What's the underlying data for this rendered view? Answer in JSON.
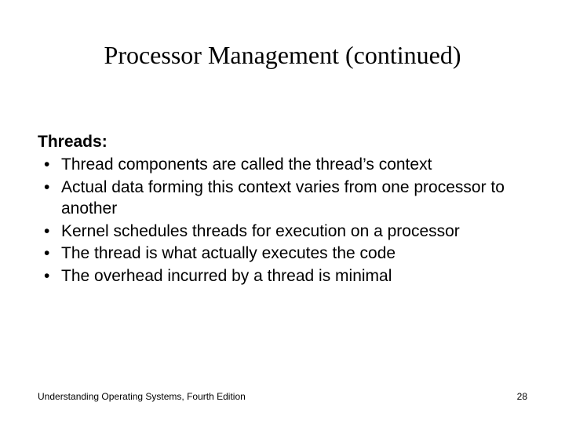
{
  "title": "Processor Management (continued)",
  "heading": "Threads:",
  "bullets": [
    "Thread components are called the thread’s context",
    "Actual data forming this context varies from one processor to another",
    "Kernel schedules threads for execution on a processor",
    "The thread is what actually executes the code",
    "The overhead incurred by a thread is minimal"
  ],
  "footer_left": "Understanding Operating Systems, Fourth Edition",
  "footer_right": "28"
}
